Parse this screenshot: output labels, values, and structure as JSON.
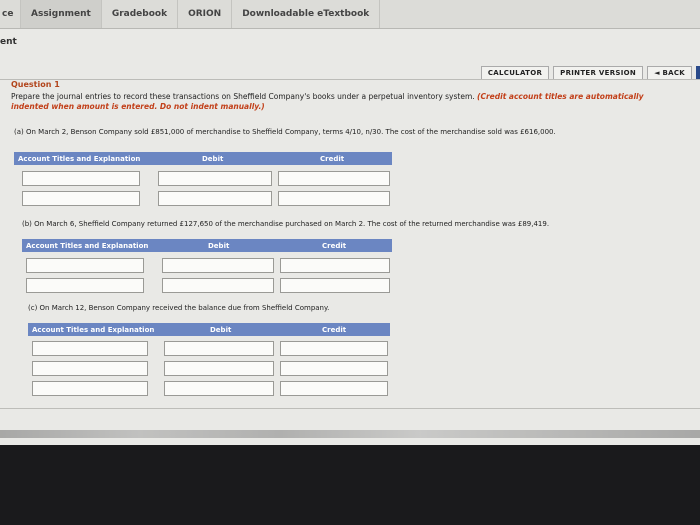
{
  "tabs": [
    "ce",
    "Assignment",
    "Gradebook",
    "ORION",
    "Downloadable eTextbook"
  ],
  "section_title": "ent",
  "toolbar": {
    "calculator": "CALCULATOR",
    "printer": "PRINTER VERSION",
    "back": "◄ BACK"
  },
  "question": {
    "title": "Question 1",
    "instruction": "Prepare the journal entries to record these transactions on Sheffield Company's books under a perpetual inventory system.",
    "note_part1": "(Credit account titles are automatically",
    "note_part2": "indented when amount is entered. Do not indent manually.)"
  },
  "columns": {
    "account": "Account Titles and Explanation",
    "debit": "Debit",
    "credit": "Credit"
  },
  "parts": [
    {
      "prompt": "(a) On March 2, Benson Company sold £851,000 of merchandise to Sheffield Company, terms 4/10, n/30. The cost of the merchandise sold was £616,000."
    },
    {
      "prompt": "(b) On March 6, Sheffield Company returned £127,650 of the merchandise purchased on March 2. The cost of the returned merchandise was £89,419."
    },
    {
      "prompt": "(c) On March 12, Benson Company received the balance due from Sheffield Company."
    }
  ]
}
